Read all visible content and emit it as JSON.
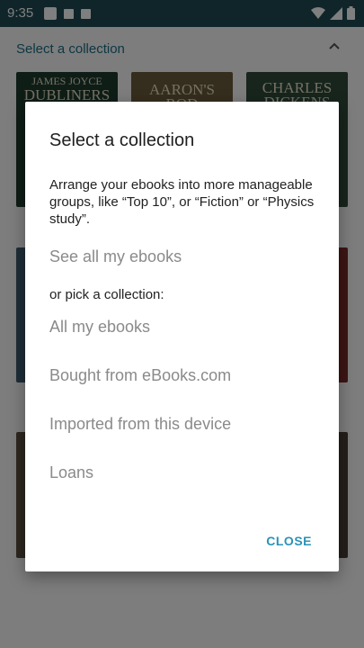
{
  "status_bar": {
    "time": "9:35",
    "icons": [
      "notification-square-icon",
      "notification-icon",
      "notification-icon",
      "wifi-icon",
      "signal-icon",
      "battery-icon"
    ]
  },
  "header": {
    "title": "Select a collection",
    "expand_icon": "chevron-up-icon"
  },
  "books": [
    {
      "title": "DUBLINERS",
      "author": "JAMES JOYCE"
    },
    {
      "title": "AARON'S ROD",
      "author": ""
    },
    {
      "title": "CHARLES DICKENS",
      "author": ""
    }
  ],
  "dialog": {
    "title": "Select a collection",
    "description": "Arrange your ebooks into more manageable groups, like “Top 10”, or “Fiction” or “Physics study”.",
    "see_all": "See all my ebooks",
    "subheading": "or pick a collection:",
    "collections": [
      "All my ebooks",
      "Bought from eBooks.com",
      "Imported from this device",
      "Loans"
    ],
    "close_label": "CLOSE"
  },
  "colors": {
    "status_bar": "#1f4a52",
    "accent": "#2b93b6",
    "title_text": "#1d6f86"
  }
}
